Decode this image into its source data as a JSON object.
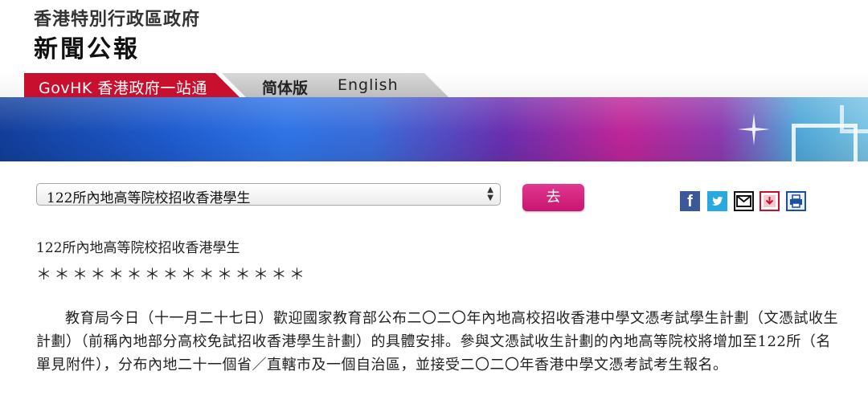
{
  "masthead": {
    "gov_name": "香港特別行政區政府",
    "press_title": "新聞公報"
  },
  "nav": {
    "govhk_label": "GovHK 香港政府一站通",
    "simplified_label": "简体版",
    "english_label": "English"
  },
  "toolbar": {
    "select_value": "122所內地高等院校招收香港學生",
    "go_label": "去",
    "share_icons": [
      "facebook-icon",
      "twitter-icon",
      "email-icon",
      "download-icon",
      "print-icon"
    ]
  },
  "article": {
    "title": "122所內地高等院校招收香港學生",
    "stars": "＊＊＊＊＊＊＊＊＊＊＊＊＊＊＊",
    "body": "教育局今日（十一月二十七日）歡迎國家教育部公布二〇二〇年內地高校招收香港中學文憑考試學生計劃（文憑試收生計劃）（前稱內地部分高校免試招收香港學生計劃）的具體安排。參與文憑試收生計劃的內地高等院校將增加至122所（名單見附件），分布內地二十一個省／直轄市及一個自治區，並接受二〇二〇年香港中學文憑考試考生報名。"
  },
  "colors": {
    "govhk_red": "#c8102e",
    "go_button_pink": "#d6257f",
    "facebook_blue": "#3b5998",
    "twitter_blue": "#2aa8e0"
  }
}
